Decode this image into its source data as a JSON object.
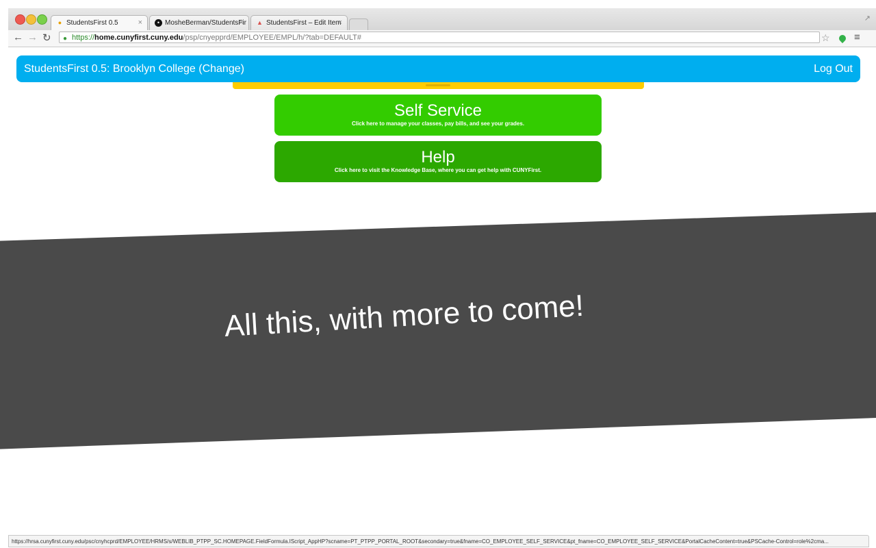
{
  "browser": {
    "tabs": [
      {
        "label": "StudentsFirst 0.5",
        "favicon": "studentsfirst-favicon"
      },
      {
        "label": "MosheBerman/StudentsFir",
        "favicon": "github-icon"
      },
      {
        "label": "StudentsFirst – Edit Item",
        "favicon": "edit-item-favicon"
      }
    ],
    "url": {
      "scheme": "https://",
      "host": "home.cunyfirst.cuny.edu",
      "path": "/psp/cnyepprd/EMPLOYEE/EMPL/h/?tab=DEFAULT#"
    },
    "status_url": "https://hrsa.cunyfirst.cuny.edu/psc/cnyhcprd/EMPLOYEE/HRMS/s/WEBLIB_PTPP_SC.HOMEPAGE.FieldFormula.IScript_AppHP?scname=PT_PTPP_PORTAL_ROOT&secondary=true&fname=CO_EMPLOYEE_SELF_SERVICE&pt_fname=CO_EMPLOYEE_SELF_SERVICE&PortalCacheContent=true&PSCache-Control=role%2cma..."
  },
  "navbar": {
    "brand": "StudentsFirst 0.5: Brooklyn College (Change)",
    "logout": "Log Out"
  },
  "tiles": [
    {
      "title": "Self Service",
      "description": "Click here to manage your classes, pay bills, and see your grades."
    },
    {
      "title": "Help",
      "description": "Click here to visit the Knowledge Base, where you can get help with CUNYFirst."
    }
  ],
  "banner": {
    "text": "All this, with more to come!"
  },
  "colors": {
    "navbar": "#00aeef",
    "self_service": "#33cc00",
    "help": "#2ca800",
    "strip": "#ffcc00",
    "banner": "#4a4a4a"
  }
}
